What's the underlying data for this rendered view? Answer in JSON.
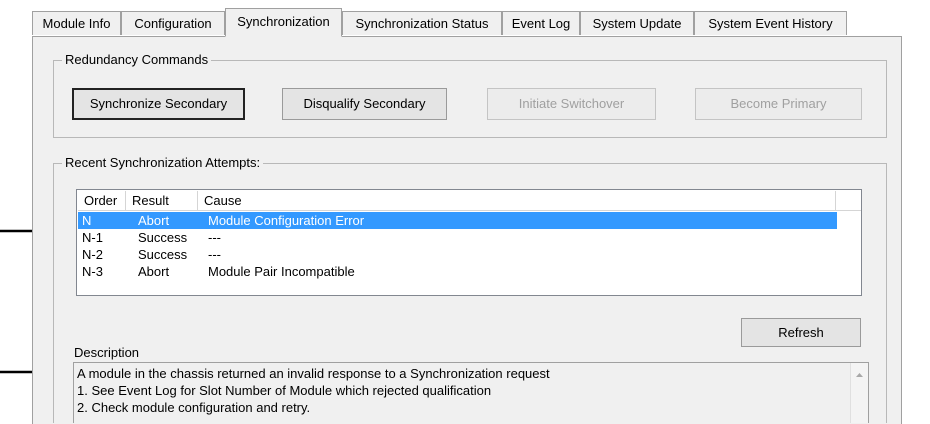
{
  "tabs": [
    {
      "label": "Module Info"
    },
    {
      "label": "Configuration"
    },
    {
      "label": "Synchronization"
    },
    {
      "label": "Synchronization Status"
    },
    {
      "label": "Event Log"
    },
    {
      "label": "System Update"
    },
    {
      "label": "System Event History"
    }
  ],
  "active_tab": "Synchronization",
  "redundancy": {
    "title": "Redundancy Commands",
    "buttons": [
      {
        "label": "Synchronize Secondary",
        "enabled": true,
        "default": true
      },
      {
        "label": "Disqualify Secondary",
        "enabled": true
      },
      {
        "label": "Initiate Switchover",
        "enabled": false
      },
      {
        "label": "Become Primary",
        "enabled": false
      }
    ]
  },
  "attempts": {
    "title": "Recent Synchronization Attempts:",
    "columns": [
      "Order",
      "Result",
      "Cause"
    ],
    "rows": [
      {
        "order": "N",
        "result": "Abort",
        "cause": "Module Configuration Error",
        "selected": true
      },
      {
        "order": "N-1",
        "result": "Success",
        "cause": "---"
      },
      {
        "order": "N-2",
        "result": "Success",
        "cause": "---"
      },
      {
        "order": "N-3",
        "result": "Abort",
        "cause": "Module Pair Incompatible"
      }
    ]
  },
  "refresh_label": "Refresh",
  "description": {
    "label": "Description",
    "lines": [
      "A module in the chassis returned an invalid response to a Synchronization request",
      "1. See Event Log for Slot Number of Module which rejected qualification",
      "2. Check module configuration and retry."
    ]
  },
  "colors": {
    "selection": "#3399ff",
    "panel": "#f0f0f0"
  },
  "icons": [
    "pointer-arrow-icon",
    "scroll-up-icon"
  ]
}
